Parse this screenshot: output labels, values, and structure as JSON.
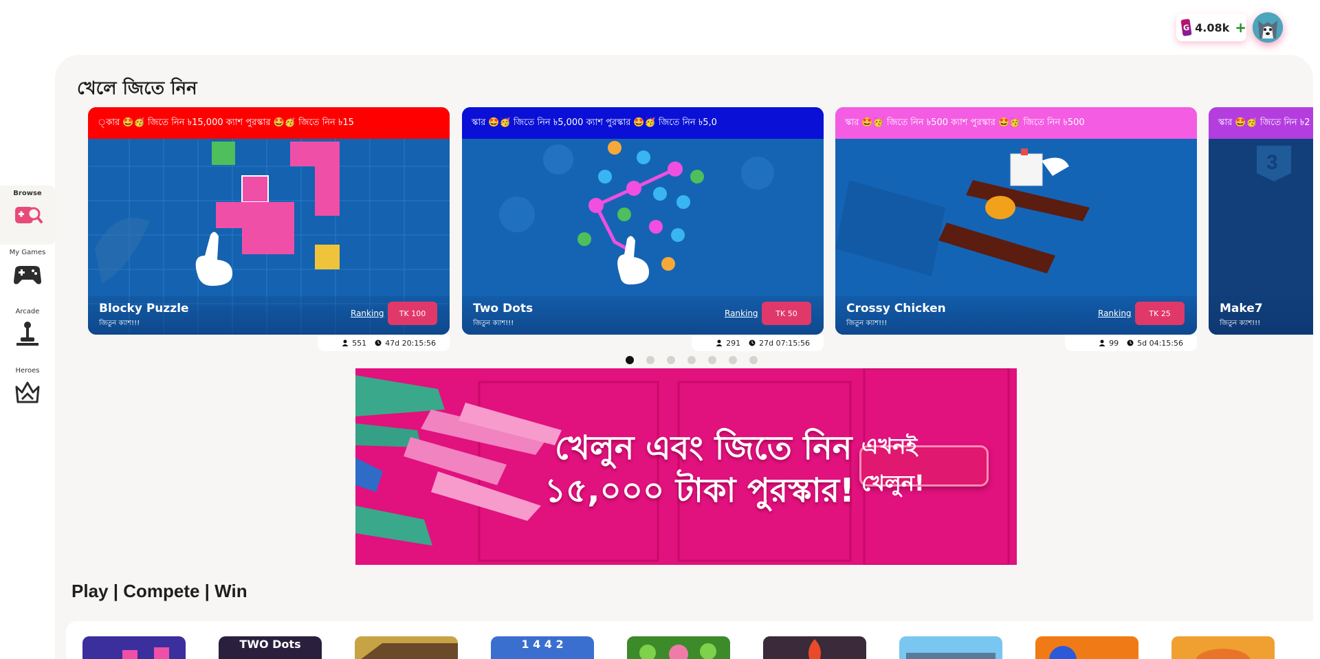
{
  "header": {
    "coin_letter": "G",
    "coin_value": "4.08k",
    "coin_plus": "+"
  },
  "sidebar": {
    "items": [
      {
        "label": "Browse",
        "icon": "gamepad-search-icon"
      },
      {
        "label": "My Games",
        "icon": "gamepad-icon"
      },
      {
        "label": "Arcade",
        "icon": "joystick-icon"
      },
      {
        "label": "Heroes",
        "icon": "crown-icon"
      }
    ]
  },
  "tournaments": {
    "title": "খেলে জিতে নিন",
    "cards": [
      {
        "ticker": "্কার 🤩🥳 জিতে নিন ৳15,000 ক্যাশ পুরস্কার 🤩🥳 জিতে নিন ৳15",
        "ticker_color": "#ff0000",
        "name": "Blocky Puzzle",
        "sub": "জিতুন ক্যাশ!!!",
        "ranking": "Ranking",
        "prize": "TK 100",
        "players": "551",
        "time": "47d 20:15:56"
      },
      {
        "ticker": "স্কার 🤩🥳 জিতে নিন ৳5,000 ক্যাশ পুরস্কার 🤩🥳 জিতে নিন ৳5,0",
        "ticker_color": "#0a10d6",
        "name": "Two Dots",
        "sub": "জিতুন ক্যাশ!!!",
        "ranking": "Ranking",
        "prize": "TK 50",
        "players": "291",
        "time": "27d 07:15:56"
      },
      {
        "ticker": "স্কার 🤩🥳 জিতে নিন ৳500 ক্যাশ পুরস্কার 🤩🥳 জিতে নিন ৳500",
        "ticker_color": "#f45ce3",
        "name": "Crossy Chicken",
        "sub": "জিতুন ক্যাশ!!!",
        "ranking": "Ranking",
        "prize": "TK 25",
        "players": "99",
        "time": "5d 04:15:56"
      },
      {
        "ticker": "স্কার 🤩🥳 জিতে নিন ৳2",
        "ticker_color": "#b43de0",
        "name": "Make7",
        "sub": "জিতুন ক্যাশ!!!"
      }
    ],
    "active_dot": 0,
    "dot_count": 7
  },
  "banner": {
    "line1": "খেলুন এবং জিতে নিন",
    "line2": "১৫,০০০ টাকা পুরস্কার!",
    "button": "এখনই খেলুন!"
  },
  "games_section": {
    "title": "Play | Compete | Win",
    "thumbs": [
      {
        "label": "",
        "color": "#3b2f9e"
      },
      {
        "label": "TWO Dots",
        "color": "#2a1f3d"
      },
      {
        "label": "",
        "color": "#c6a446"
      },
      {
        "label": "1 4 4 2",
        "color": "#3a6fd0"
      },
      {
        "label": "",
        "color": "#3d8a2a"
      },
      {
        "label": "",
        "color": "#3b2a3a"
      },
      {
        "label": "",
        "color": "#79c6f0"
      },
      {
        "label": "",
        "color": "#f07b16"
      },
      {
        "label": "",
        "color": "#f0a030"
      }
    ]
  }
}
